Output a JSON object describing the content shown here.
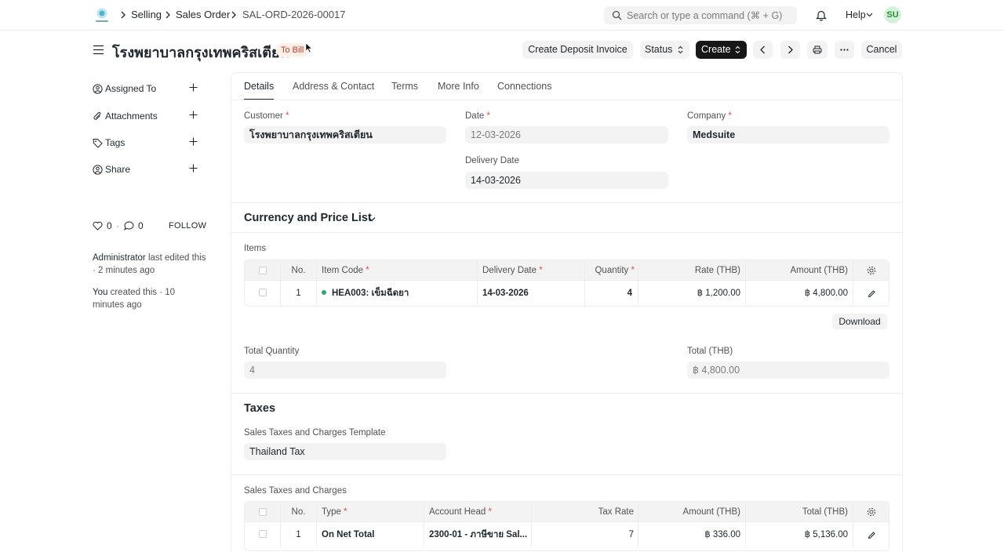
{
  "navbar": {
    "breadcrumbs": [
      "Selling",
      "Sales Order",
      "SAL-ORD-2026-00017"
    ],
    "search_placeholder": "Search or type a command (⌘ + G)",
    "help_label": "Help",
    "avatar_initials": "SU"
  },
  "page": {
    "title": "โรงพยาบาลกรุงเทพคริสเตียน",
    "status": "To Bill",
    "buttons": {
      "deposit": "Create Deposit Invoice",
      "status": "Status",
      "create": "Create",
      "cancel": "Cancel"
    }
  },
  "sidebar": {
    "items": [
      {
        "label": "Assigned To",
        "icon": "user-plus-icon"
      },
      {
        "label": "Attachments",
        "icon": "paperclip-icon"
      },
      {
        "label": "Tags",
        "icon": "tag-icon"
      },
      {
        "label": "Share",
        "icon": "share-user-icon"
      }
    ],
    "likes": "0",
    "comments": "0",
    "follow": "FOLLOW",
    "activity": [
      {
        "actor": "Administrator",
        "text": " last edited this · 2 minutes ago"
      },
      {
        "actor": "You",
        "text": " created this · 10 minutes ago"
      }
    ]
  },
  "tabs": [
    "Details",
    "Address & Contact",
    "Terms",
    "More Info",
    "Connections"
  ],
  "details": {
    "customer_label": "Customer",
    "customer_value": "โรงพยาบาลกรุงเทพคริสเตียน",
    "date_label": "Date",
    "date_value": "12-03-2026",
    "company_label": "Company",
    "company_value": "Medsuite",
    "delivery_label": "Delivery Date",
    "delivery_value": "14-03-2026"
  },
  "currency_section": "Currency and Price List",
  "items": {
    "label": "Items",
    "headers": [
      "No.",
      "Item Code",
      "Delivery Date",
      "Quantity",
      "Rate (THB)",
      "Amount (THB)"
    ],
    "rows": [
      {
        "no": "1",
        "item_code": "HEA003: เข็มฉีดยา",
        "delivery_date": "14-03-2026",
        "qty": "4",
        "rate": "฿ 1,200.00",
        "amount": "฿ 4,800.00"
      }
    ],
    "download": "Download"
  },
  "totals": {
    "total_qty_label": "Total Quantity",
    "total_qty_value": "4",
    "total_label": "Total (THB)",
    "total_value": "฿ 4,800.00"
  },
  "taxes": {
    "heading": "Taxes",
    "template_label": "Sales Taxes and Charges Template",
    "template_value": "Thailand Tax",
    "table_label": "Sales Taxes and Charges",
    "headers": [
      "No.",
      "Type",
      "Account Head",
      "Tax Rate",
      "Amount (THB)",
      "Total (THB)"
    ],
    "rows": [
      {
        "no": "1",
        "type": "On Net Total",
        "account_head": "2300-01 - ภาษีขาย Sal...",
        "tax_rate": "7",
        "amount": "฿ 336.00",
        "total": "฿ 5,136.00"
      }
    ]
  },
  "colors": {
    "primary_dark": "#171717",
    "status_text": "#c4372b",
    "status_bg": "#fff1e7",
    "required": "#e24c4c",
    "in_stock_dot": "#30a66d"
  }
}
